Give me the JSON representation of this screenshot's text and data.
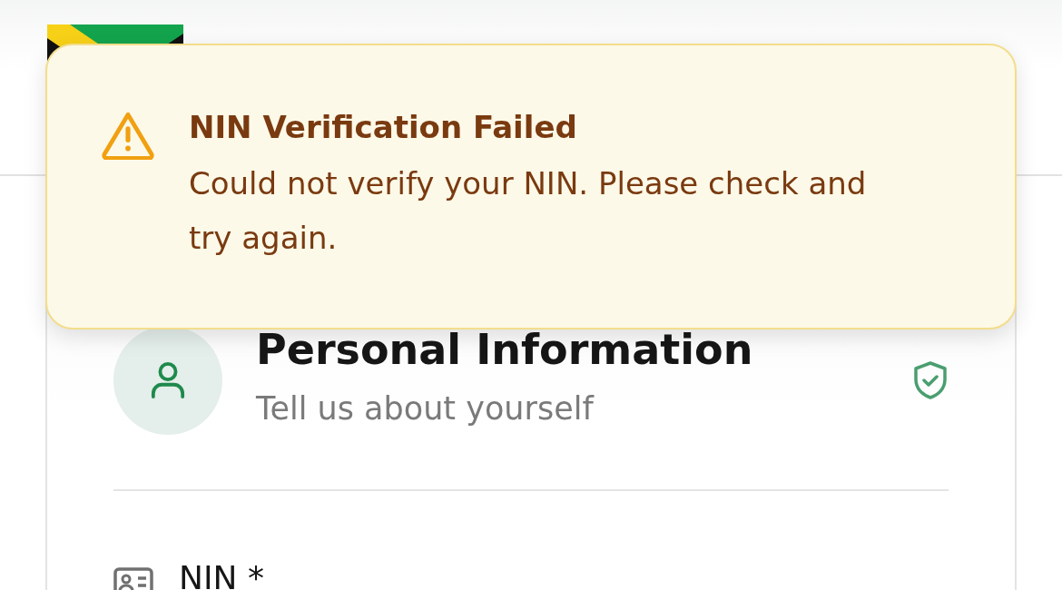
{
  "toast": {
    "kind": "warning",
    "title": "NIN Verification Failed",
    "message": "Could not verify your NIN. Please check and try again."
  },
  "section": {
    "title": "Personal Information",
    "subtitle": "Tell us about yourself",
    "verified": true
  },
  "fields": [
    {
      "label": "NIN *"
    }
  ]
}
